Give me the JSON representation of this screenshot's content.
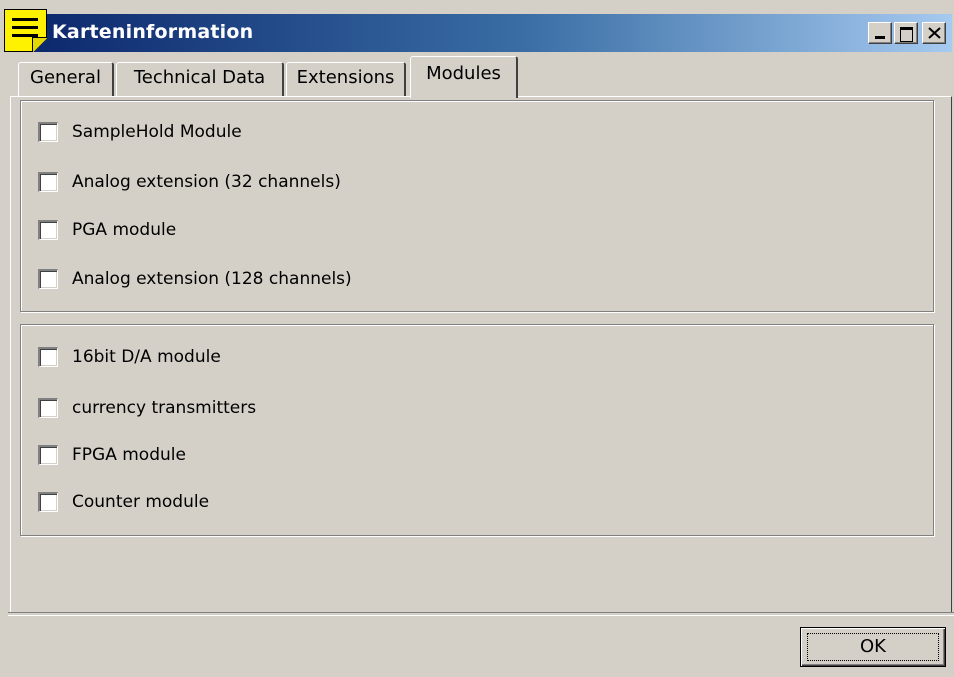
{
  "window": {
    "title": "Karteninformation",
    "controls": [
      "minimize",
      "maximize",
      "close"
    ]
  },
  "tabs": [
    {
      "label": "General",
      "active": false
    },
    {
      "label": "Technical Data",
      "active": false
    },
    {
      "label": "Extensions",
      "active": false
    },
    {
      "label": "Modules",
      "active": true
    }
  ],
  "group1": {
    "items": [
      {
        "label": "SampleHold Module",
        "checked": false
      },
      {
        "label": "Analog extension (32 channels)",
        "checked": false
      },
      {
        "label": "PGA module",
        "checked": false
      },
      {
        "label": "Analog extension (128 channels)",
        "checked": false
      }
    ]
  },
  "group2": {
    "items": [
      {
        "label": "16bit D/A module",
        "checked": false
      },
      {
        "label": "currency transmitters",
        "checked": false
      },
      {
        "label": "FPGA module",
        "checked": false
      },
      {
        "label": "Counter module",
        "checked": false
      }
    ]
  },
  "buttons": {
    "ok_label": "OK"
  },
  "colors": {
    "titlebar_start": "#0a246a",
    "titlebar_end": "#a6caf0",
    "face": "#d4d0c8",
    "note_icon": "#fff200"
  }
}
